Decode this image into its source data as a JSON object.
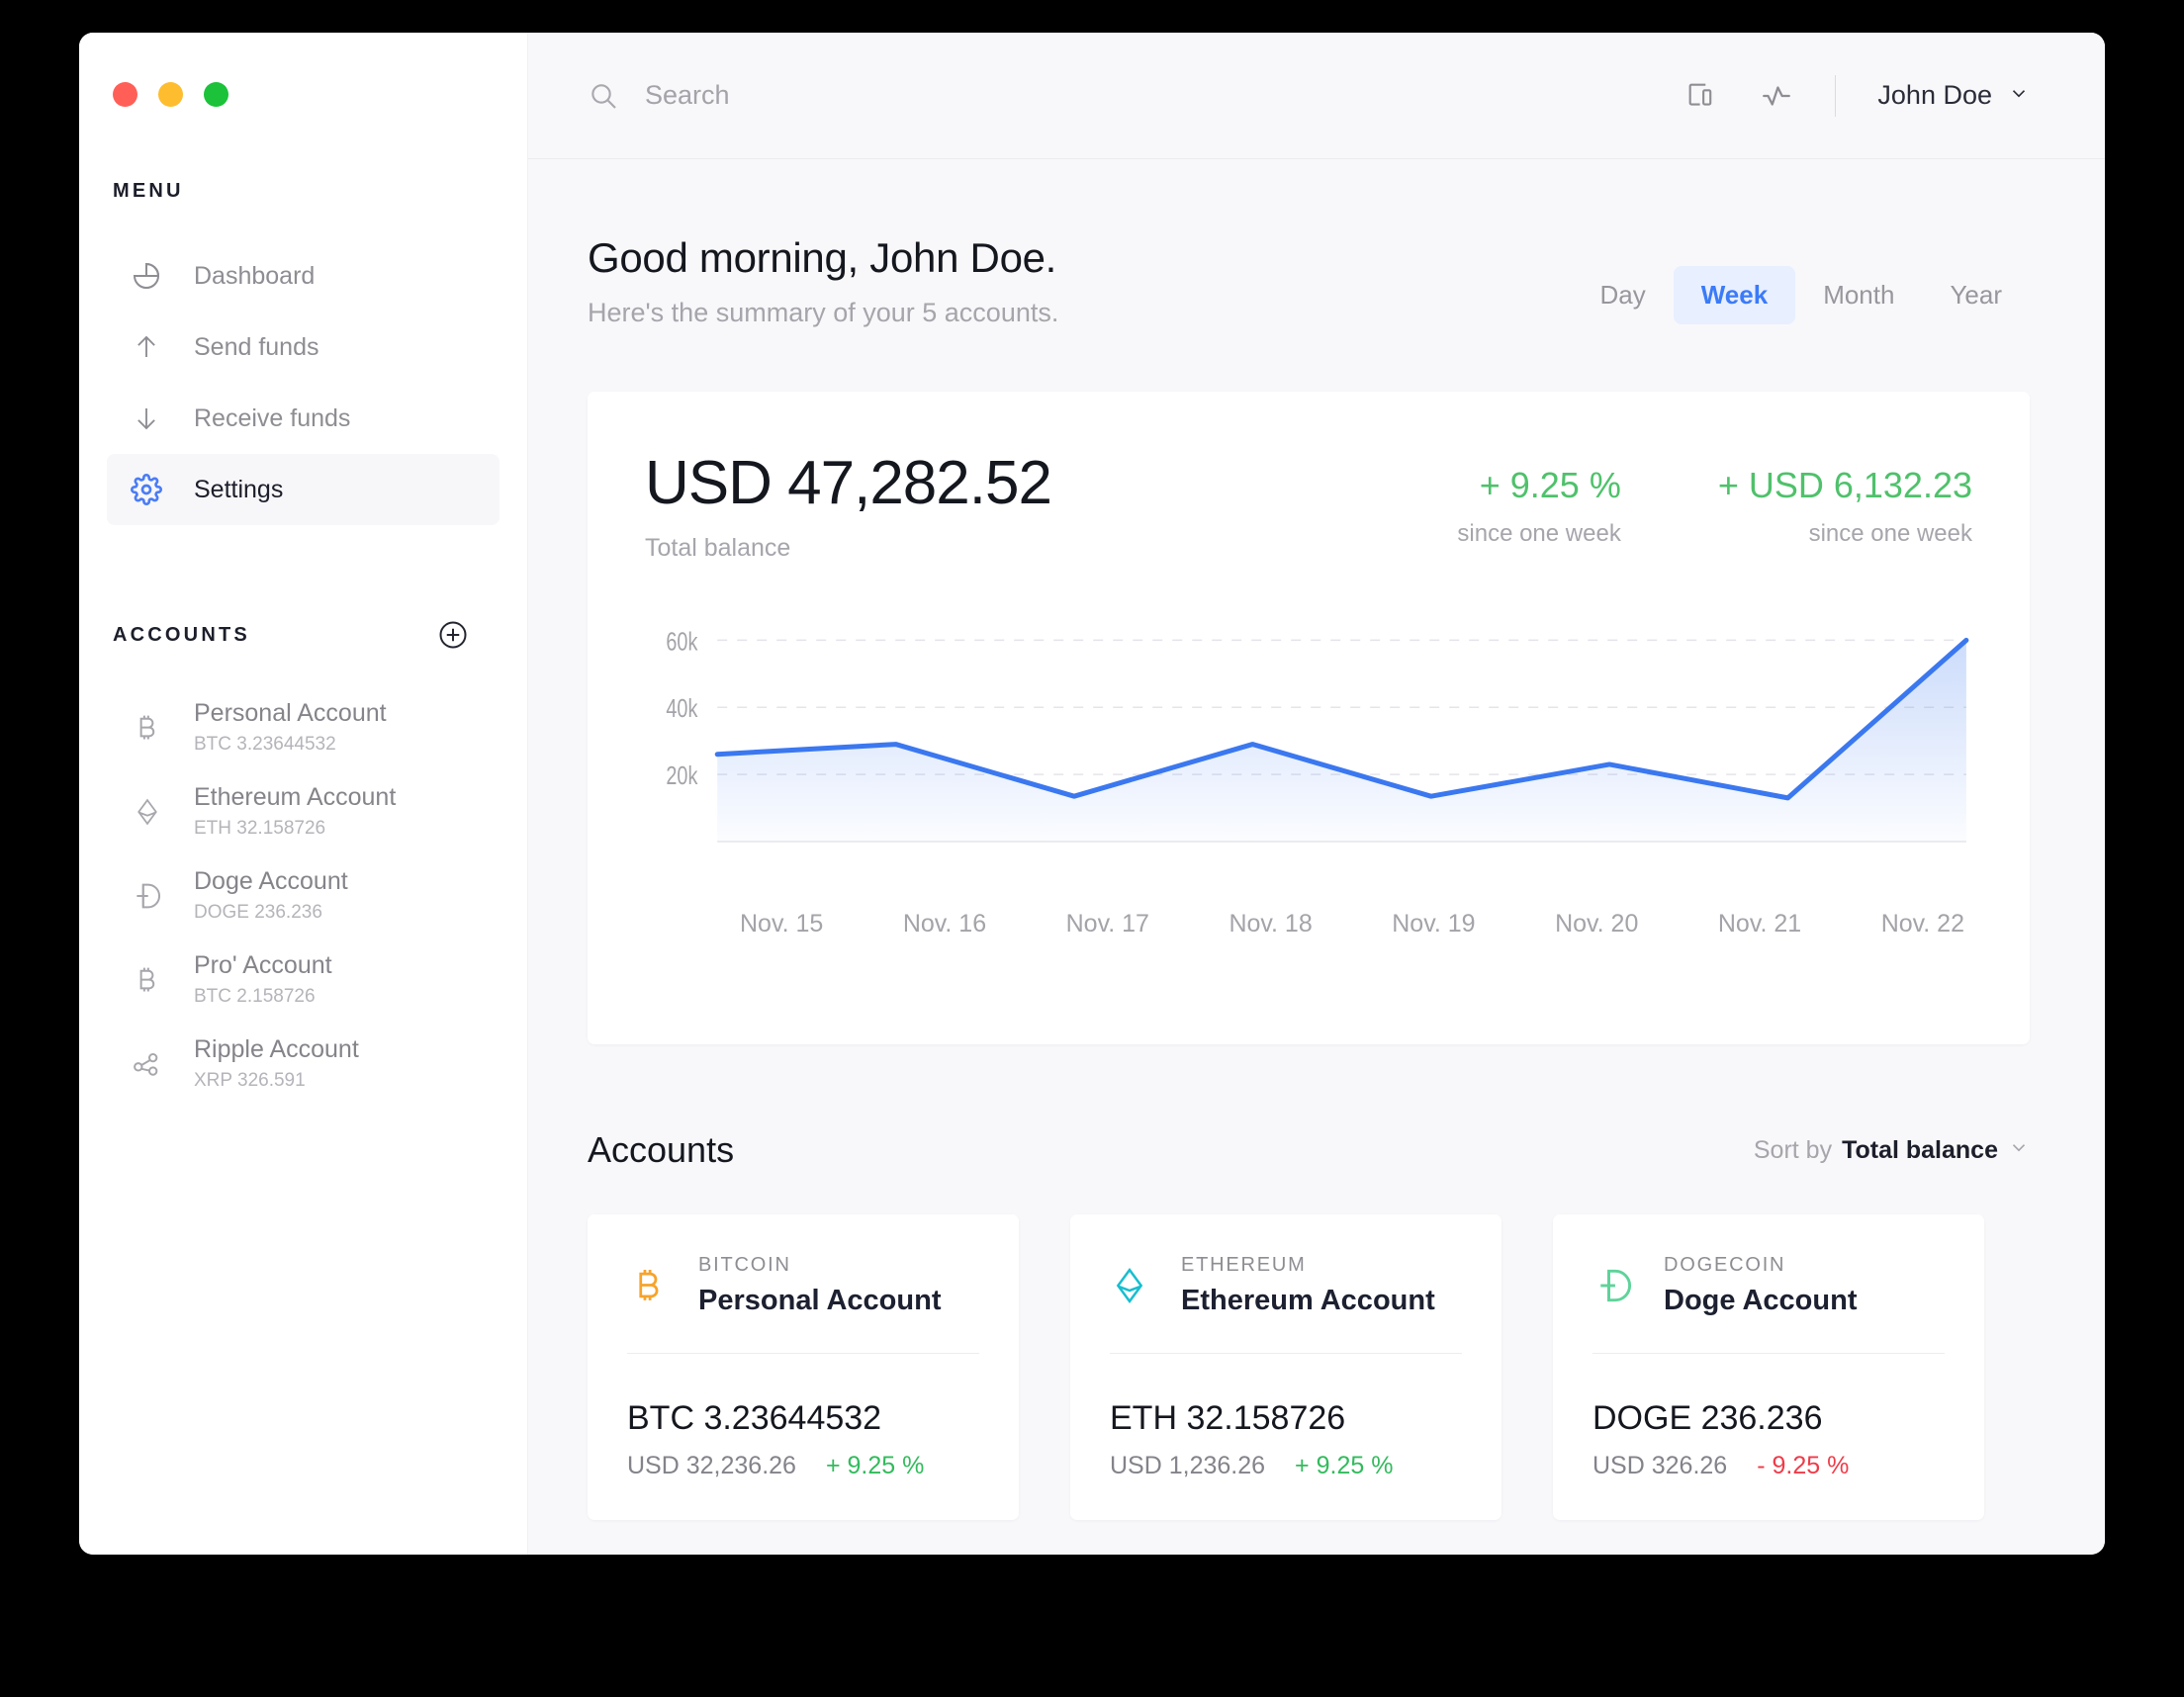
{
  "window": {
    "traffic_lights": [
      "close",
      "minimize",
      "maximize"
    ]
  },
  "sidebar": {
    "menu_label": "MENU",
    "nav": [
      {
        "label": "Dashboard",
        "icon": "pie-chart-icon",
        "active": false
      },
      {
        "label": "Send funds",
        "icon": "arrow-up-icon",
        "active": false
      },
      {
        "label": "Receive funds",
        "icon": "arrow-down-icon",
        "active": false
      },
      {
        "label": "Settings",
        "icon": "gear-icon",
        "active": true
      }
    ],
    "accounts_label": "ACCOUNTS",
    "add_account_icon": "plus-circle-icon",
    "accounts": [
      {
        "name": "Personal Account",
        "balance": "BTC 3.23644532",
        "icon": "bitcoin-icon"
      },
      {
        "name": "Ethereum Account",
        "balance": "ETH 32.158726",
        "icon": "ethereum-icon"
      },
      {
        "name": "Doge Account",
        "balance": "DOGE 236.236",
        "icon": "dogecoin-icon"
      },
      {
        "name": "Pro' Account",
        "balance": "BTC 2.158726",
        "icon": "bitcoin-icon"
      },
      {
        "name": "Ripple Account",
        "balance": "XRP 326.591",
        "icon": "ripple-icon"
      }
    ]
  },
  "topbar": {
    "search_placeholder": "Search",
    "search_value": "",
    "search_icon": "search-icon",
    "device_icon": "devices-icon",
    "activity_icon": "activity-pulse-icon",
    "user_name": "John Doe",
    "user_chevron": "chevron-down-icon"
  },
  "header": {
    "greeting": "Good morning, John Doe.",
    "subtitle": "Here's the summary of your 5 accounts.",
    "ranges": [
      {
        "label": "Day",
        "active": false
      },
      {
        "label": "Week",
        "active": true
      },
      {
        "label": "Month",
        "active": false
      },
      {
        "label": "Year",
        "active": false
      }
    ]
  },
  "balance_card": {
    "amount": "USD 47,282.52",
    "label": "Total balance",
    "stats": [
      {
        "value": "+ 9.25 %",
        "sub": "since one week",
        "color": "#4fc16b"
      },
      {
        "value": "+ USD 6,132.23",
        "sub": "since one week",
        "color": "#4fc16b"
      }
    ]
  },
  "chart_data": {
    "type": "area",
    "title": "",
    "xlabel": "",
    "ylabel": "",
    "categories": [
      "Nov. 15",
      "Nov. 16",
      "Nov. 17",
      "Nov. 18",
      "Nov. 19",
      "Nov. 20",
      "Nov. 21",
      "Nov. 22"
    ],
    "values": [
      26000,
      29000,
      13500,
      29000,
      13500,
      23000,
      13000,
      60000
    ],
    "ytick_labels": [
      "20k",
      "40k",
      "60k"
    ],
    "ytick_values": [
      20000,
      40000,
      60000
    ],
    "ylim": [
      0,
      66000
    ],
    "grid": true,
    "grid_style": "dashed-horizontal",
    "legend": "none",
    "line_color": "#3b78f0",
    "fill_color": "#3b78f0"
  },
  "accounts_section": {
    "title": "Accounts",
    "sort_prefix": "Sort by",
    "sort_value": "Total balance",
    "sort_chevron": "chevron-down-icon",
    "cards": [
      {
        "kind": "BITCOIN",
        "name": "Personal Account",
        "amount": "BTC 3.23644532",
        "usd": "USD 32,236.26",
        "change": "+ 9.25 %",
        "change_dir": "up",
        "icon": "bitcoin-icon",
        "icon_color": "#f7a32b"
      },
      {
        "kind": "ETHEREUM",
        "name": "Ethereum Account",
        "amount": "ETH 32.158726",
        "usd": "USD 1,236.26",
        "change": "+ 9.25 %",
        "change_dir": "up",
        "icon": "ethereum-icon",
        "icon_color": "#17bed0"
      },
      {
        "kind": "DOGECOIN",
        "name": "Doge Account",
        "amount": "DOGE 236.236",
        "usd": "USD 326.26",
        "change": "- 9.25 %",
        "change_dir": "down",
        "icon": "dogecoin-icon",
        "icon_color": "#5fd39a"
      }
    ]
  }
}
